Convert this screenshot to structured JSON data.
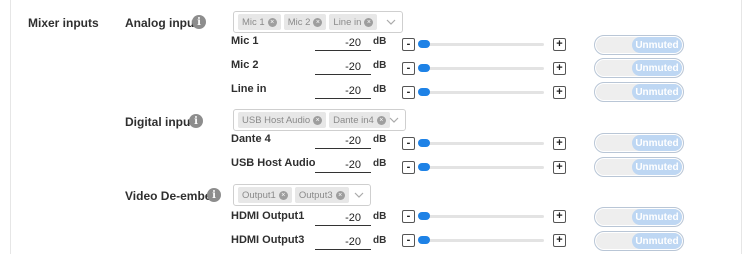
{
  "section": {
    "label": "Mixer inputs"
  },
  "info_glyph": "i",
  "unit": "dB",
  "minus_label": "-",
  "plus_label": "+",
  "groups": [
    {
      "label": "Analog input",
      "selected": [
        "Mic 1",
        "Mic 2",
        "Line in"
      ],
      "channels": [
        {
          "name": "Mic 1",
          "gain": "-20",
          "level": 0.0,
          "mute_label": "Unmuted"
        },
        {
          "name": "Mic 2",
          "gain": "-20",
          "level": 0.0,
          "mute_label": "Unmuted"
        },
        {
          "name": "Line in",
          "gain": "-20",
          "level": 0.0,
          "mute_label": "Unmuted"
        }
      ]
    },
    {
      "label": "Digital input",
      "selected": [
        "USB Host Audio",
        "Dante in4"
      ],
      "channels": [
        {
          "name": "Dante 4",
          "gain": "-20",
          "level": 0.0,
          "mute_label": "Unmuted"
        },
        {
          "name": "USB Host Audio",
          "gain": "-20",
          "level": 0.0,
          "mute_label": "Unmuted"
        }
      ]
    },
    {
      "label": "Video De-embed",
      "selected": [
        "Output1",
        "Output3"
      ],
      "channels": [
        {
          "name": "HDMI Output1",
          "gain": "-20",
          "level": 0.0,
          "mute_label": "Unmuted"
        },
        {
          "name": "HDMI Output3",
          "gain": "-20",
          "level": 0.0,
          "mute_label": "Unmuted"
        }
      ]
    }
  ],
  "colors": {
    "accent": "#1e82e6",
    "toggle_on": "#bed7f3"
  }
}
